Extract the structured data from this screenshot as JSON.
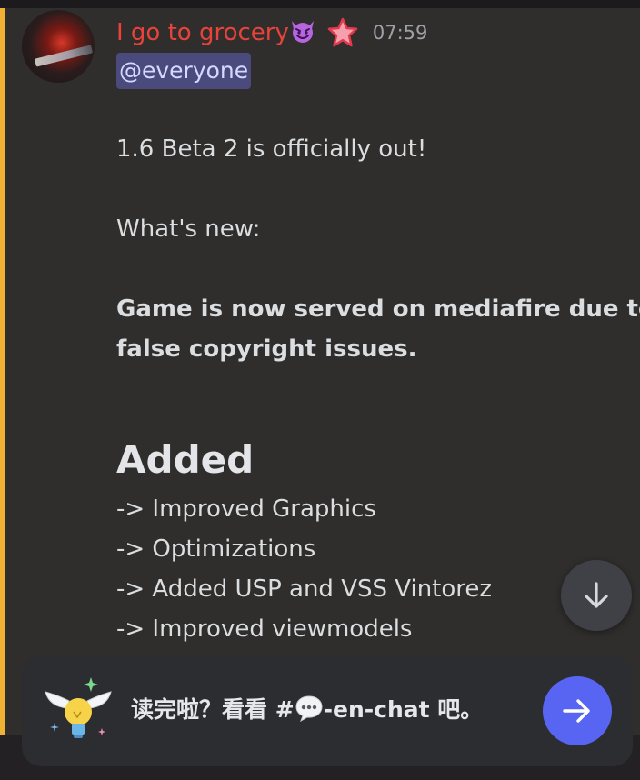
{
  "message": {
    "author": "I go to grocery",
    "timestamp": "07:59",
    "mention": "@everyone",
    "lines": [
      "1.6 Beta 2 is officially out!",
      "What's new:",
      "Game is now served on mediafire due to",
      "false copyright issues."
    ],
    "heading": "Added",
    "changes": [
      "-> Improved Graphics",
      "-> Optimizations",
      "-> Added USP and VSS Vintorez",
      "-> Improved viewmodels"
    ]
  },
  "prompt": {
    "text_before": "读完啦？看看 #",
    "text_after": "-en-chat 吧。"
  },
  "icons": {
    "author_badge": "smiling-devil-icon",
    "role_badge": "star-icon",
    "scroll": "arrow-down-icon",
    "prompt_emoji": "speech-bubble-icon",
    "prompt_art": "winged-lightbulb-icon",
    "send": "arrow-right-icon"
  },
  "colors": {
    "author": "#e8433b",
    "mention_bg": "#4a4a7c",
    "mention_bar": "#f0b232",
    "accent": "#5865f2"
  }
}
